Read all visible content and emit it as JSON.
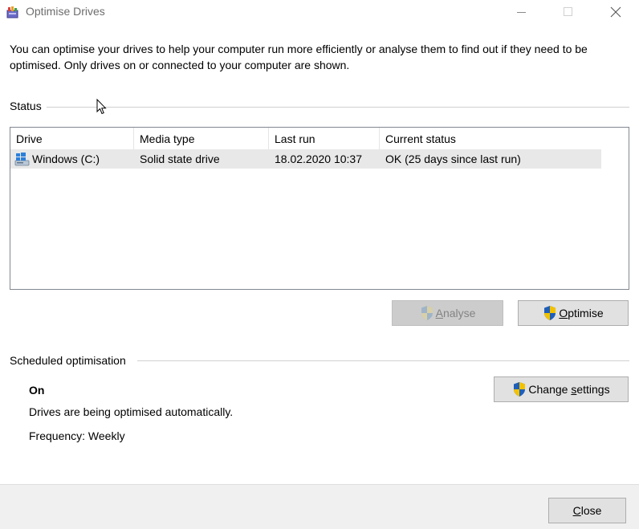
{
  "window": {
    "title": "Optimise Drives",
    "controls": [
      "minimize",
      "maximize",
      "close"
    ]
  },
  "intro_text": "You can optimise your drives to help your computer run more efficiently or analyse them to find out if they need to be optimised. Only drives on or connected to your computer are shown.",
  "status": {
    "label": "Status",
    "columns": [
      "Drive",
      "Media type",
      "Last run",
      "Current status"
    ],
    "rows": [
      {
        "drive": "Windows (C:)",
        "media_type": "Solid state drive",
        "last_run": "18.02.2020 10:37",
        "current_status": "OK (25 days since last run)",
        "icon": "windows-drive-icon"
      }
    ]
  },
  "buttons": {
    "analyse": {
      "label": "Analyse",
      "accesskey": "A",
      "rest": "nalyse",
      "enabled": false
    },
    "optimise": {
      "label": "Optimise",
      "accesskey": "O",
      "rest": "ptimise",
      "enabled": true
    },
    "change_settings": {
      "label": "Change settings",
      "prefix": "Change ",
      "accesskey": "s",
      "rest": "ettings",
      "enabled": true
    },
    "close": {
      "label": "Close",
      "accesskey": "C",
      "rest": "lose"
    }
  },
  "scheduled": {
    "label": "Scheduled optimisation",
    "state": "On",
    "description": "Drives are being optimised automatically.",
    "frequency": "Frequency: Weekly"
  },
  "colors": {
    "shield_blue": "#1f5fb8",
    "shield_yellow": "#f2c200",
    "selected_row": "#e8e8e8",
    "footer": "#f0f0f0"
  }
}
